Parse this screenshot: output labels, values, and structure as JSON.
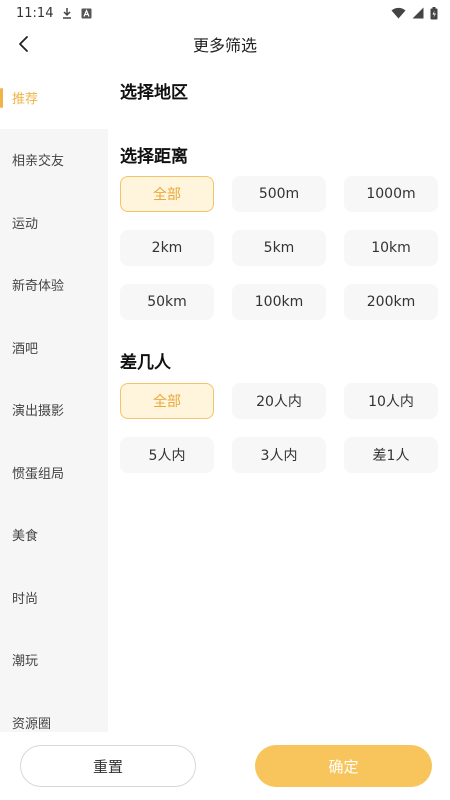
{
  "status_bar": {
    "time": "11:14",
    "icons": [
      "download-icon",
      "a-badge-icon",
      "wifi-icon",
      "signal-icon",
      "battery-icon"
    ]
  },
  "header": {
    "title": "更多筛选",
    "back_icon": "chevron-left-icon"
  },
  "sidebar": {
    "active_index": 0,
    "items": [
      {
        "label": "推荐"
      },
      {
        "label": "相亲交友"
      },
      {
        "label": "运动"
      },
      {
        "label": "新奇体验"
      },
      {
        "label": "酒吧"
      },
      {
        "label": "演出摄影"
      },
      {
        "label": "惯蛋组局"
      },
      {
        "label": "美食"
      },
      {
        "label": "时尚"
      },
      {
        "label": "潮玩"
      },
      {
        "label": "资源圈"
      }
    ]
  },
  "sections": {
    "region": {
      "title": "选择地区"
    },
    "distance": {
      "title": "选择距离",
      "selected_index": 0,
      "options": [
        "全部",
        "500m",
        "1000m",
        "2km",
        "5km",
        "10km",
        "50km",
        "100km",
        "200km"
      ]
    },
    "people": {
      "title": "差几人",
      "selected_index": 0,
      "options": [
        "全部",
        "20人内",
        "10人内",
        "5人内",
        "3人内",
        "差1人"
      ]
    }
  },
  "footer": {
    "reset_label": "重置",
    "confirm_label": "确定"
  },
  "colors": {
    "accent": "#f1b448",
    "selected_bg": "#fff4dc",
    "confirm_bg": "#f8c55d",
    "sidebar_bg": "#f6f6f6"
  }
}
